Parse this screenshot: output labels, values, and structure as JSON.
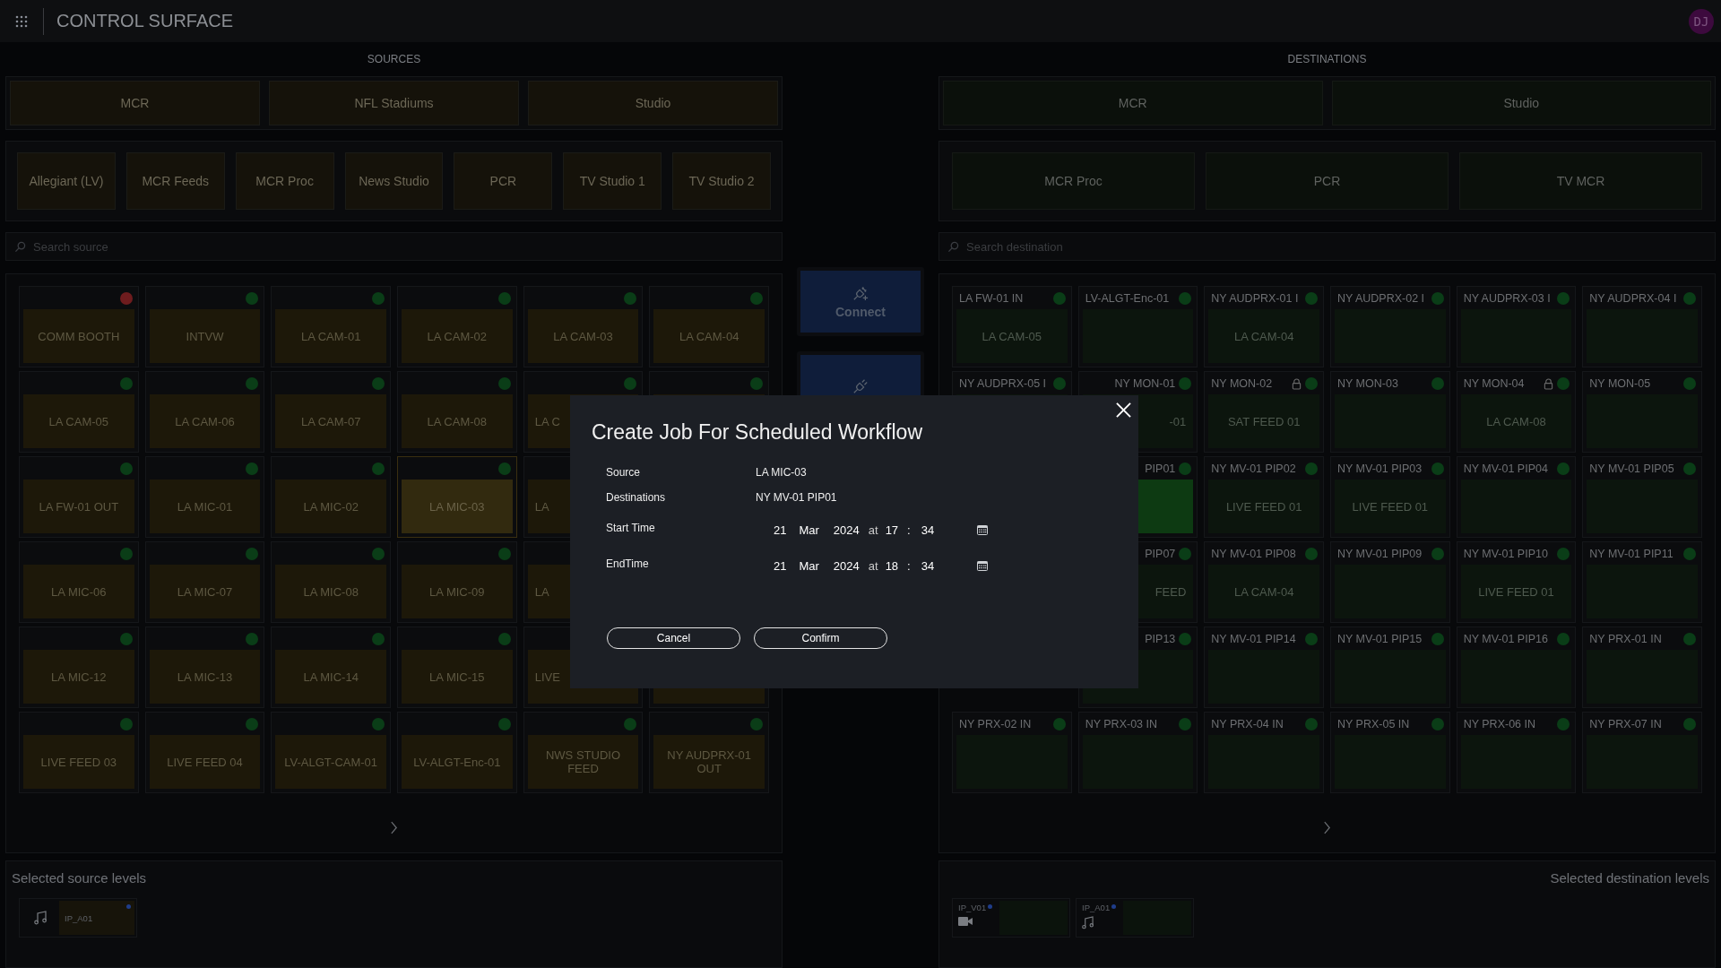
{
  "header": {
    "title": "CONTROL SURFACE",
    "avatar": "DJ"
  },
  "sources": {
    "heading": "SOURCES",
    "groups": [
      "MCR",
      "NFL Stadiums",
      "Studio"
    ],
    "subgroups": [
      "Allegiant (LV)",
      "MCR Feeds",
      "MCR Proc",
      "News Studio",
      "PCR",
      "TV Studio 1",
      "TV Studio 2"
    ],
    "search": {
      "placeholder": "Search source"
    },
    "tiles": [
      {
        "name": "COMM BOOTH",
        "color": "#6e1c1e",
        "selected": false
      },
      {
        "name": "INTVW",
        "color": "#0a3d17",
        "selected": false
      },
      {
        "name": "LA CAM-01",
        "color": "#0a3d17",
        "selected": false
      },
      {
        "name": "LA CAM-02",
        "color": "#0a3d17",
        "selected": false
      },
      {
        "name": "LA CAM-03",
        "color": "#0a3d17",
        "selected": false
      },
      {
        "name": "LA CAM-04",
        "color": "#0a3d17",
        "selected": false
      },
      {
        "name": "LA CAM-05",
        "color": "#0a3d17",
        "selected": false
      },
      {
        "name": "LA CAM-06",
        "color": "#0a3d17",
        "selected": false
      },
      {
        "name": "LA CAM-07",
        "color": "#0a3d17",
        "selected": false
      },
      {
        "name": "LA CAM-08",
        "color": "#0a3d17",
        "selected": false
      },
      {
        "name": "LA C",
        "color": "#0a3d17",
        "selected": false,
        "kind": "cut_right"
      },
      {
        "color": "#0a3d17",
        "selected": false
      },
      {
        "name": "LA FW-01 OUT",
        "color": "#0a3d17",
        "selected": false
      },
      {
        "name": "LA MIC-01",
        "color": "#0a3d17",
        "selected": false
      },
      {
        "name": "LA MIC-02",
        "color": "#0a3d17",
        "selected": false
      },
      {
        "name": "LA MIC-03",
        "color": "#0a3d17",
        "selected": true
      },
      {
        "name": "LA",
        "selected": false,
        "kind": "cut_right"
      },
      {
        "kind": "covered"
      },
      {
        "name": "LA MIC-06",
        "color": "#0a3d17",
        "selected": false
      },
      {
        "name": "LA MIC-07",
        "color": "#0a3d17",
        "selected": false
      },
      {
        "name": "LA MIC-08",
        "color": "#0a3d17",
        "selected": false
      },
      {
        "name": "LA MIC-09",
        "color": "#0a3d17",
        "selected": false
      },
      {
        "name": "LA",
        "selected": false,
        "kind": "cut_right"
      },
      {
        "kind": "covered"
      },
      {
        "name": "LA MIC-12",
        "color": "#0a3d17",
        "selected": false
      },
      {
        "name": "LA MIC-13",
        "color": "#0a3d17",
        "selected": false
      },
      {
        "name": "LA MIC-14",
        "color": "#0a3d17",
        "selected": false
      },
      {
        "name": "LA MIC-15",
        "color": "#0a3d17",
        "selected": false
      },
      {
        "name": "LIVE",
        "selected": false,
        "kind": "cut_right"
      },
      {
        "selected": false
      },
      {
        "name": "LIVE FEED 03",
        "color": "#0a3d17",
        "selected": false
      },
      {
        "name": "LIVE FEED 04",
        "color": "#0a3d17",
        "selected": false
      },
      {
        "name": "LV-ALGT-CAM-01",
        "color": "#0a3d17",
        "selected": false
      },
      {
        "name": "LV-ALGT-Enc-01",
        "color": "#0a3d17",
        "selected": false
      },
      {
        "name": "NWS STUDIO FEED",
        "color": "#0a3d17",
        "selected": false
      },
      {
        "name": "NY AUDPRX-01 OUT",
        "color": "#0a3d17",
        "selected": false
      }
    ]
  },
  "connect": {
    "label": "Connect"
  },
  "destinations": {
    "heading": "DESTINATIONS",
    "groups": [
      "MCR",
      "Studio"
    ],
    "subgroups": [
      "MCR Proc",
      "PCR",
      "TV MCR"
    ],
    "search": {
      "placeholder": "Search destination"
    },
    "tiles": [
      {
        "name": "LA FW-01 IN",
        "source": "LA CAM-05",
        "color": "#0a3d17",
        "locked": false,
        "selected": false
      },
      {
        "name": "LV-ALGT-Enc-01",
        "color": "#0a3d17",
        "locked": false,
        "selected": false
      },
      {
        "name": "NY AUDPRX-01 I",
        "source": "LA CAM-04",
        "color": "#0a3d17",
        "locked": false,
        "selected": false
      },
      {
        "name": "NY AUDPRX-02 I",
        "color": "#0a3d17",
        "locked": false,
        "selected": false
      },
      {
        "name": "NY AUDPRX-03 I",
        "color": "#0a3d17",
        "locked": false,
        "selected": false
      },
      {
        "name": "NY AUDPRX-04 I",
        "color": "#0a3d17",
        "locked": false,
        "selected": false
      },
      {
        "name": "NY AUDPRX-05 I",
        "color": "#0a3d17",
        "locked": false,
        "selected": false
      },
      {
        "name": "NY MON-01",
        "source": "-01",
        "color": "#0a3d17",
        "locked": false,
        "selected": false,
        "kind": "cut_left"
      },
      {
        "name": "NY MON-02",
        "source": "SAT FEED 01",
        "color": "#0a3d17",
        "locked": true,
        "selected": false
      },
      {
        "name": "NY MON-03",
        "color": "#0a3d17",
        "locked": false,
        "selected": false
      },
      {
        "name": "NY MON-04",
        "source": "LA CAM-08",
        "color": "#0a3d17",
        "locked": true,
        "selected": false
      },
      {
        "name": "NY MON-05",
        "color": "#0a3d17",
        "locked": false,
        "selected": false
      },
      {
        "kind": "covered"
      },
      {
        "name": "PIP01",
        "color": "#0a3d17",
        "locked": false,
        "selected": true,
        "kind": "cut_left"
      },
      {
        "name": "NY MV-01 PIP02",
        "source": "LIVE FEED 01",
        "color": "#0a3d17",
        "locked": false,
        "selected": false
      },
      {
        "name": "NY MV-01 PIP03",
        "source": "LIVE FEED 01",
        "color": "#0a3d17",
        "locked": false,
        "selected": false
      },
      {
        "name": "NY MV-01 PIP04",
        "color": "#0a3d17",
        "locked": false,
        "selected": false
      },
      {
        "name": "NY MV-01 PIP05",
        "color": "#0a3d17",
        "locked": false,
        "selected": false
      },
      {
        "kind": "covered"
      },
      {
        "name": "PIP07",
        "source": "FEED",
        "color": "#0a3d17",
        "locked": false,
        "selected": false,
        "kind": "cut_left"
      },
      {
        "name": "NY MV-01 PIP08",
        "source": "LA CAM-04",
        "color": "#0a3d17",
        "locked": false,
        "selected": false
      },
      {
        "name": "NY MV-01 PIP09",
        "color": "#0a3d17",
        "locked": false,
        "selected": false
      },
      {
        "name": "NY MV-01 PIP10",
        "source": "LIVE FEED 01",
        "color": "#0a3d17",
        "locked": false,
        "selected": false
      },
      {
        "name": "NY MV-01 PIP11",
        "color": "#0a3d17",
        "locked": false,
        "selected": false
      },
      {
        "kind": "covered"
      },
      {
        "name": "PIP13",
        "color": "#0a3d17",
        "locked": false,
        "selected": false,
        "kind": "cut_left"
      },
      {
        "name": "NY MV-01 PIP14",
        "color": "#0a3d17",
        "locked": false,
        "selected": false
      },
      {
        "name": "NY MV-01 PIP15",
        "color": "#0a3d17",
        "locked": false,
        "selected": false
      },
      {
        "name": "NY MV-01 PIP16",
        "color": "#0a3d17",
        "locked": false,
        "selected": false
      },
      {
        "name": "NY PRX-01 IN",
        "color": "#0a3d17",
        "locked": false,
        "selected": false
      },
      {
        "name": "NY PRX-02 IN",
        "color": "#0a3d17",
        "locked": false,
        "selected": false
      },
      {
        "name": "NY PRX-03 IN",
        "color": "#0a3d17",
        "locked": false,
        "selected": false
      },
      {
        "name": "NY PRX-04 IN",
        "color": "#0a3d17",
        "locked": false,
        "selected": false
      },
      {
        "name": "NY PRX-05 IN",
        "color": "#0a3d17",
        "locked": false,
        "selected": false
      },
      {
        "name": "NY PRX-06 IN",
        "color": "#0a3d17",
        "locked": false,
        "selected": false
      },
      {
        "name": "NY PRX-07 IN",
        "color": "#0a3d17",
        "locked": false,
        "selected": false
      }
    ]
  },
  "source_levels": {
    "title": "Selected source levels",
    "items": [
      {
        "kind": "audio",
        "label": "IP_A01"
      }
    ]
  },
  "destination_levels": {
    "title": "Selected destination levels",
    "items": [
      {
        "kind": "video",
        "label": "IP_V01"
      },
      {
        "kind": "audio",
        "label": "IP_A01"
      }
    ]
  },
  "modal": {
    "title": "Create Job For Scheduled Workflow",
    "fields": [
      {
        "label": "Source",
        "value": "LA MIC-03"
      },
      {
        "label": "Destinations",
        "value": "NY MV-01 PIP01"
      }
    ],
    "times": [
      {
        "label": "Start Time",
        "day": "21",
        "month": "Mar",
        "year": "2024",
        "at": "at",
        "hour": "17",
        "sep": ":",
        "minute": "34"
      },
      {
        "label": "EndTime",
        "day": "21",
        "month": "Mar",
        "year": "2024",
        "at": "at",
        "hour": "18",
        "sep": ":",
        "minute": "34"
      }
    ],
    "buttons": [
      "Cancel",
      "Confirm"
    ]
  }
}
